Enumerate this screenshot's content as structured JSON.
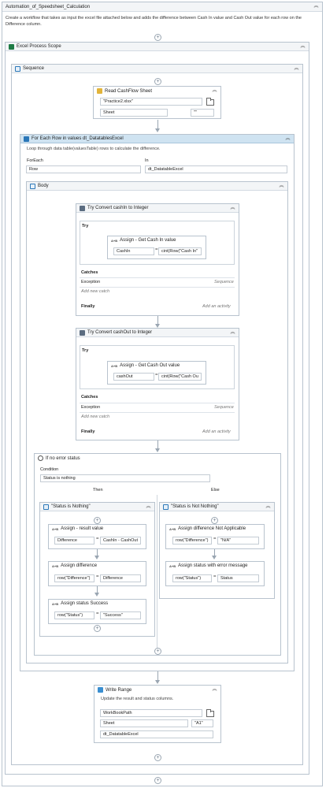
{
  "workflow": {
    "title": "Automation_of_Speedsheet_Calculation",
    "description": "Create a workflow that takes as input the excel file attached below and adds the difference between Cash In value and Cash Out value for each row on the Difference column."
  },
  "excel_scope": {
    "title": "Excel Process Scope"
  },
  "sequence": {
    "title": "Sequence"
  },
  "read_sheet": {
    "title": "Read CashFlow Sheet",
    "file_value": "\"Practice2.xlsx\"",
    "sheet_value": "Sheet",
    "range_value": "\"\""
  },
  "for_each": {
    "title": "For Each Row in values dt_DatatablesExcel",
    "description": "Loop through data table(valuesTable) rows to calculate the difference.",
    "foreach_label": "ForEach",
    "foreach_value": "Row",
    "in_label": "In",
    "in_value": "dt_DatatableExcel"
  },
  "body": {
    "title": "Body"
  },
  "try_cashin": {
    "title": "Try Convert cashIn to Integer",
    "try_label": "Try",
    "assign_title": "Assign - Get Cash In value",
    "assign_to": "CashIn",
    "assign_value": "cint(Row(\"Cash In\"",
    "catches_label": "Catches",
    "exception_label": "Exception",
    "sequence_label": "Sequence",
    "add_catch": "Add new catch",
    "finally_label": "Finally",
    "add_activity": "Add an activity"
  },
  "try_cashout": {
    "title": "Try Convert cashOut to Integer",
    "try_label": "Try",
    "assign_title": "Assign - Get Cash Out value",
    "assign_to": "cashOut",
    "assign_value": "cint(Row(\"Cash Ou",
    "catches_label": "Catches",
    "exception_label": "Exception",
    "sequence_label": "Sequence",
    "add_catch": "Add new catch",
    "finally_label": "Finally",
    "add_activity": "Add an activity"
  },
  "if_block": {
    "title": "If no error status",
    "condition_label": "Condition",
    "condition_value": "Status is nothing",
    "then_label": "Then",
    "else_label": "Else"
  },
  "then_seq": {
    "title": "\"Status is Nothing\"",
    "assign1_title": "Assign - result value",
    "assign1_to": "Difference",
    "assign1_value": "CashIn - CashOut",
    "assign2_title": "Assign difference",
    "assign2_to": "row(\"Difference\")",
    "assign2_value": "Difference",
    "assign3_title": "Assign status Success",
    "assign3_to": "row(\"Status\")",
    "assign3_value": "\"Success\""
  },
  "else_seq": {
    "title": "\"Status is Not Nothing\"",
    "assign1_title": "Assign difference Not Applicable",
    "assign1_to": "row(\"Difference\")",
    "assign1_value": "\"N/A\"",
    "assign2_title": "Assign status with error message",
    "assign2_to": "row(\"Status\")",
    "assign2_value": "Status"
  },
  "write_range": {
    "title": "Write Range",
    "description": "Update the result and status columns.",
    "workbook_value": "WorkBookPath",
    "sheet_value": "Sheet",
    "cell_value": "\"A1\"",
    "datatable_value": "dt_DatatableExcel"
  },
  "icons": {
    "collapse": "chevron-up-icon",
    "add": "plus-icon",
    "assign": "assign-icon",
    "folder": "folder-icon"
  },
  "colors": {
    "foreach_header": "#cfe3f1",
    "excel_icon": "#1e7b45",
    "border": "#b8c3ce"
  }
}
